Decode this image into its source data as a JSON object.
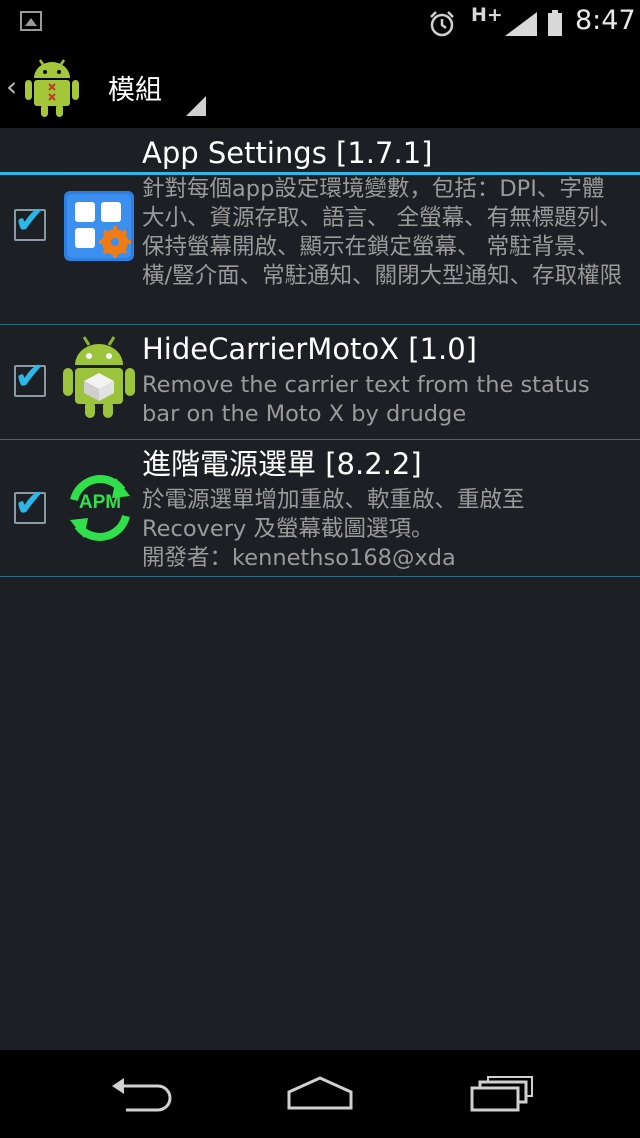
{
  "status_bar": {
    "network_type": "H+",
    "time": "8:47",
    "icons": [
      "image-notification-icon",
      "alarm-icon",
      "signal-icon",
      "battery-icon"
    ]
  },
  "action_bar": {
    "title": "模組",
    "icons": [
      "back-chevron-icon",
      "android-logo-icon"
    ]
  },
  "modules": [
    {
      "title": "App Settings [1.7.1]",
      "description": "針對每個app設定環境變數，包括：DPI、字體大小、資源存取、語言、 全螢幕、有無標題列、保持螢幕開啟、顯示在鎖定螢幕、 常駐背景、橫/豎介面、常駐通知、關閉大型通知、存取權限",
      "checked": true,
      "icon": "app-settings-icon"
    },
    {
      "title": "HideCarrierMotoX [1.0]",
      "description": "Remove the carrier text from the status bar on the Moto X by drudge",
      "checked": true,
      "icon": "android-package-icon"
    },
    {
      "title": "進階電源選單 [8.2.2]",
      "description": "於電源選單增加重啟、軟重啟、重啟至 Recovery 及螢幕截圖選項。",
      "author": "開發者：kennethso168@xda",
      "checked": true,
      "icon": "apm-icon",
      "icon_text": "APM"
    }
  ],
  "nav_bar": {
    "buttons": [
      "back-icon",
      "home-icon",
      "recents-icon"
    ]
  },
  "colors": {
    "accent": "#33b5e5",
    "checkbox_tick": "#2bb7e8",
    "background": "#1c1f23",
    "divider": "#2e6b80"
  }
}
